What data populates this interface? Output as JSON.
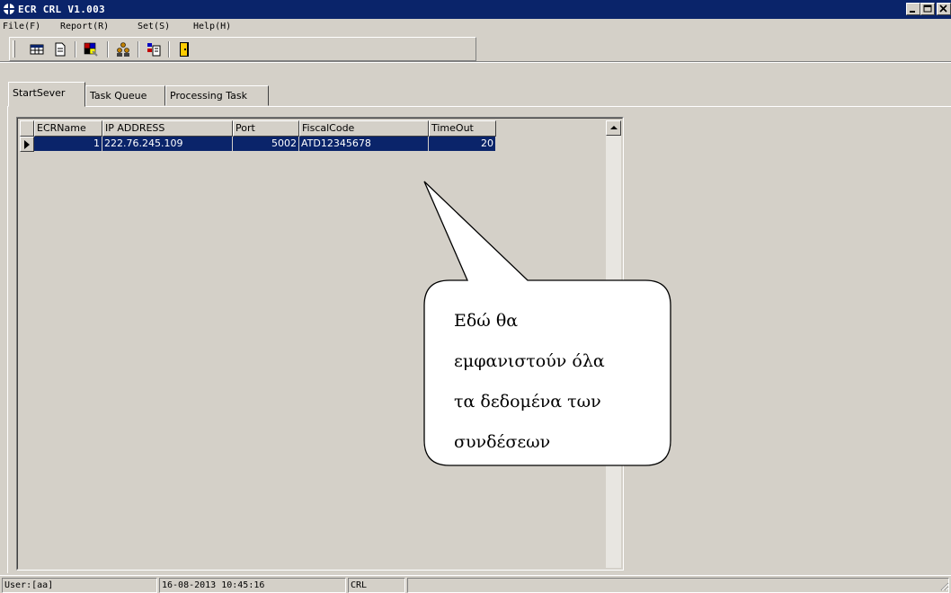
{
  "window": {
    "title": "ECR CRL V1.003"
  },
  "menu": [
    "File(F)",
    "Report(R)",
    "Set(S)",
    "Help(H)"
  ],
  "toolbar": {
    "icons": [
      "grid-view-icon",
      "document-icon",
      "palette-icon",
      "users-icon",
      "report-icon",
      "exit-door-icon"
    ]
  },
  "tabs": [
    "StartSever",
    "Task Queue",
    "Processing Task"
  ],
  "grid": {
    "columns": [
      "ECRName",
      "IP ADDRESS",
      "Port",
      "FiscalCode",
      "TimeOut"
    ],
    "rows": [
      {
        "ecr_name": "1",
        "ip_address": "222.76.245.109",
        "port": "5002",
        "fiscal_code": "ATD12345678",
        "timeout": "20"
      }
    ]
  },
  "callout": {
    "lines": [
      "Εδώ θα",
      "εμφανιστούν όλα",
      "τα δεδομένα των",
      "συνδέσεων"
    ]
  },
  "status": {
    "user": "User:[aa]",
    "datetime": "16-08-2013 10:45:16",
    "mode": "CRL"
  },
  "colors": {
    "title_bar": "#0a246a",
    "selection": "#0a246a",
    "face": "#d4d0c8"
  }
}
